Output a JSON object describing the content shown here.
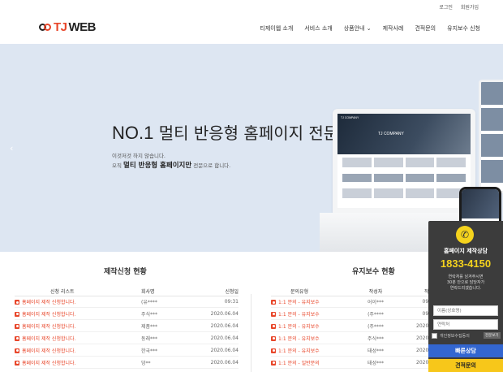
{
  "topbar": {
    "login": "로그인",
    "signup": "회원가입"
  },
  "logo": {
    "part1": "TJ",
    "part2": "WEB"
  },
  "nav": {
    "items": [
      "티제이웹 소개",
      "서비스 소개",
      "상품안내",
      "제작사례",
      "견적문의",
      "유지보수 신청"
    ],
    "dropdown_index": 2
  },
  "hero": {
    "headline_no": "NO.1",
    "headline_rest": " 멀티 반응형 홈페이지 전문",
    "sub1": "이것저것 하지 않습니다.",
    "sub2_pre": "오직 ",
    "sub2_bold": "멀티 반응형 홈페이지만",
    "sub2_post": " 전문으로 합니다.",
    "laptop_brand": "TJ COMPANY",
    "laptop_banner": "TJ COMPANY",
    "arrow": "‹"
  },
  "production": {
    "title": "제작신청 현황",
    "columns": [
      "신청 리스트",
      "회사명",
      "신청일"
    ],
    "rows": [
      {
        "text": "홈페이지 제작 신청합니다.",
        "company": "(유****",
        "date": "09:31",
        "color": "red"
      },
      {
        "text": "홈페이지 제작 신청합니다.",
        "company": "주식***",
        "date": "2020.06.04",
        "color": "red"
      },
      {
        "text": "홈페이지 제작 신청합니다.",
        "company": "제품***",
        "date": "2020.06.04",
        "color": "red"
      },
      {
        "text": "홈페이지 제작 신청합니다.",
        "company": "동래***",
        "date": "2020.06.04",
        "color": "red"
      },
      {
        "text": "홈페이지 제작 신청합니다.",
        "company": "한국***",
        "date": "2020.06.04",
        "color": "red"
      },
      {
        "text": "홈페이지 제작 신청합니다.",
        "company": "덩**",
        "date": "2020.06.04",
        "color": "red"
      }
    ]
  },
  "maintenance": {
    "title": "유지보수 현황",
    "columns": [
      "문의유형",
      "작성자",
      "작성"
    ],
    "rows": [
      {
        "text": "1:1 문의 - 유지보수",
        "author": "어이***",
        "date": "09:5"
      },
      {
        "text": "1:1 문의 - 유지보수",
        "author": "(주****",
        "date": "09:5"
      },
      {
        "text": "1:1 문의 - 유지보수",
        "author": "(주****",
        "date": "2020.0"
      },
      {
        "text": "1:1 문의 - 유지보수",
        "author": "주식***",
        "date": "2020.0"
      },
      {
        "text": "1:1 문의 - 유지보수",
        "author": "태성***",
        "date": "2020.0"
      },
      {
        "text": "1:1 문의 - 일반문의",
        "author": "태성***",
        "date": "2020.0"
      }
    ]
  },
  "widget": {
    "title": "홈페이지 제작상담",
    "phone": "1833-4150",
    "desc": [
      "연락처를 남겨주시면",
      "30분 안으로 담당자가",
      "연락드리겠습니다."
    ],
    "name_placeholder": "이름(상호명)",
    "contact_placeholder": "연락처",
    "agree": "개인정보수집동의",
    "view": "전문보기",
    "quick_button": "빠른상담",
    "estimate_button": "견적문의"
  }
}
